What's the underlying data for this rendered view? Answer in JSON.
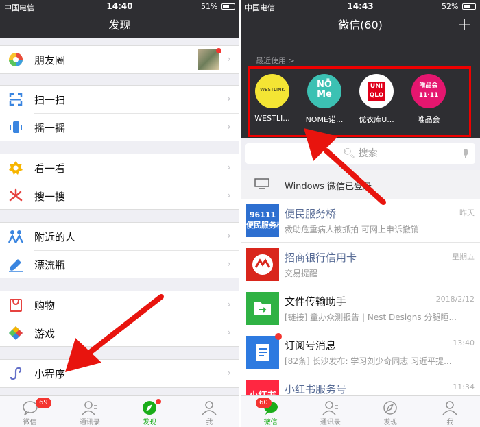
{
  "left": {
    "status": {
      "carrier": "中国电信",
      "time": "14:40",
      "battery": "51%"
    },
    "title": "发现",
    "items": [
      {
        "label": "朋友圈"
      },
      {
        "label": "扫一扫"
      },
      {
        "label": "摇一摇"
      },
      {
        "label": "看一看"
      },
      {
        "label": "搜一搜"
      },
      {
        "label": "附近的人"
      },
      {
        "label": "漂流瓶"
      },
      {
        "label": "购物"
      },
      {
        "label": "游戏"
      },
      {
        "label": "小程序"
      }
    ],
    "tabs": [
      {
        "label": "微信",
        "badge": "69"
      },
      {
        "label": "通讯录"
      },
      {
        "label": "发现"
      },
      {
        "label": "我"
      }
    ]
  },
  "right": {
    "status": {
      "carrier": "中国电信",
      "time": "14:43",
      "battery": "52%"
    },
    "title": "微信(60)",
    "recent_title": "最近使用 >",
    "mini_programs": [
      {
        "name": "WESTLI...",
        "logo_text": "WESTLINK"
      },
      {
        "name": "NOME诺...",
        "logo_text": "NŌ\nMe"
      },
      {
        "name": "优衣库U...",
        "logo_text": "UNI\nQLO"
      },
      {
        "name": "唯品会",
        "logo_text": "唯品会\n11·11"
      }
    ],
    "search_placeholder": "搜索",
    "windows_notice": "Windows 微信已登录",
    "chats": [
      {
        "name": "便民服务桥",
        "msg": "救助危重病人被抓拍 可网上申诉撤销",
        "time": "昨天",
        "avatar_text": "96111\n便民服务桥"
      },
      {
        "name": "招商银行信用卡",
        "msg": "交易提醒",
        "time": "星期五"
      },
      {
        "name": "文件传输助手",
        "msg": "[链接] 童办众测报告 | Nest Designs 分腿睡...",
        "time": "2018/2/12"
      },
      {
        "name": "订阅号消息",
        "msg": "[82条] 长沙发布: 学习刘少奇同志 习近平提...",
        "time": "13:40"
      },
      {
        "name": "小红书服务号",
        "msg": "",
        "time": "11:34",
        "avatar_text": "小红书"
      }
    ],
    "tabs": [
      {
        "label": "微信",
        "badge": "60"
      },
      {
        "label": "通讯录"
      },
      {
        "label": "发现"
      },
      {
        "label": "我"
      }
    ]
  },
  "colors": {
    "accent": "#1aad19",
    "dark_bar": "#2e2e32",
    "badge": "#f43530",
    "arrow": "#e8140e"
  }
}
